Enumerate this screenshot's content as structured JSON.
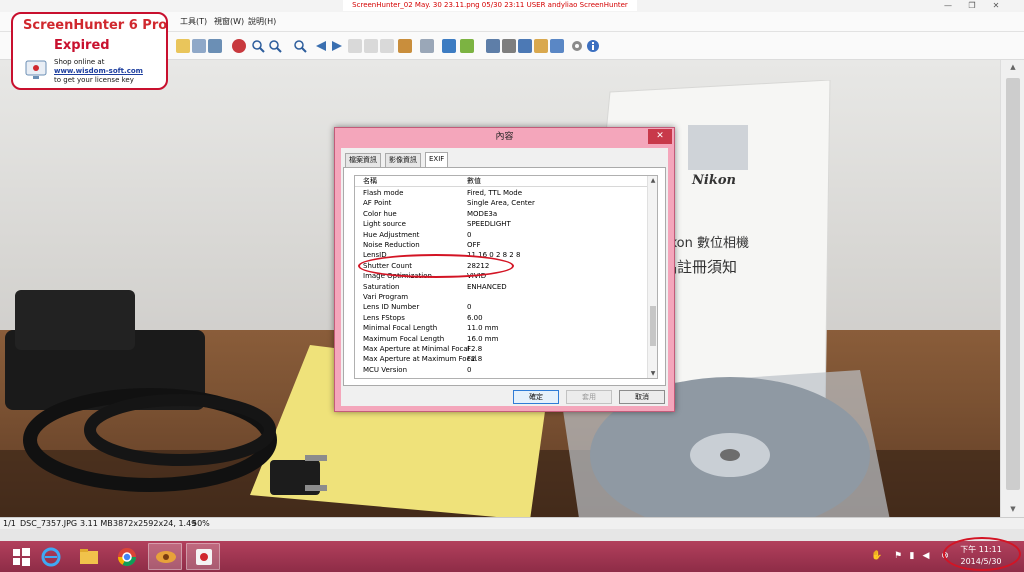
{
  "capture_banner": "ScreenHunter_02 May. 30 23.11.png  05/30  23:11  USER  andyliao  ScreenHunter",
  "window_controls": {
    "minimize": "—",
    "restore": "❐",
    "close": "✕"
  },
  "menu": {
    "items": [
      "工具(T)",
      "視窗(W)",
      "說明(H)"
    ]
  },
  "watermark": {
    "brand": "ScreenHunter 6 Pro",
    "status": "Expired",
    "line1": "Shop online at",
    "site": "www.wisdom-soft.com",
    "line3": "to get your license key"
  },
  "dialog": {
    "title": "內容",
    "close_icon": "✕",
    "tabs": [
      "檔案資訊",
      "影像資訊",
      "EXIF"
    ],
    "selected_tab": "EXIF",
    "columns": [
      "名稱",
      "數值"
    ],
    "rows": [
      [
        "Flash mode",
        "Fired, TTL Mode"
      ],
      [
        "AF Point",
        "Single Area, Center"
      ],
      [
        "Color hue",
        "MODE3a"
      ],
      [
        "Light source",
        "SPEEDLIGHT"
      ],
      [
        "Hue Adjustment",
        "0"
      ],
      [
        "Noise Reduction",
        "OFF"
      ],
      [
        "LensID",
        "11 16 0 2 8 2 8"
      ],
      [
        "Shutter Count",
        "28212"
      ],
      [
        "Image Optimization",
        "VIVID"
      ],
      [
        "Saturation",
        "ENHANCED"
      ],
      [
        "Vari Program",
        ""
      ],
      [
        "Lens ID Number",
        "0"
      ],
      [
        "Lens FStops",
        "6.00"
      ],
      [
        "Minimal Focal Length",
        "11.0 mm"
      ],
      [
        "Maximum Focal Length",
        "16.0 mm"
      ],
      [
        "Max Aperture at Minimal Focal",
        "F2.8"
      ],
      [
        "Max Aperture at Maximum Focal",
        "F2.8"
      ],
      [
        "MCU Version",
        "0"
      ]
    ],
    "buttons": {
      "ok": "確定",
      "apply": "套用",
      "cancel": "取消"
    }
  },
  "statusbar": {
    "index": "1/1",
    "filename": "DSC_7357.JPG",
    "filesize": "3.11 MB",
    "dimensions": "3872x2592x24, 1.49",
    "zoom": "50%"
  },
  "scroll_arrows": {
    "up": "▲",
    "down": "▼"
  },
  "taskbar": {
    "apps": [
      "start-icon",
      "internet-explorer-icon",
      "file-explorer-icon",
      "chrome-icon",
      "image-viewer-icon",
      "screenhunter-icon"
    ]
  },
  "clock": {
    "time": "下午 11:11",
    "date": "2014/5/30"
  },
  "colors": {
    "taskbar": "#9c3350",
    "dialog_frame": "#f4a6bb",
    "annotation": "#d31424",
    "watermark_red": "#c8102e"
  }
}
